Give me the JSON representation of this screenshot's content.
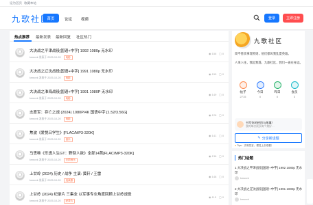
{
  "topbar": {
    "links": [
      "设为首页",
      "收藏本站"
    ]
  },
  "header": {
    "logo": "九歌社区",
    "nav": {
      "home": "首页",
      "forum": "论坛",
      "video": "视频"
    },
    "login": "登录",
    "register": "立即注册"
  },
  "tabs": [
    "热点推荐",
    "最新发表",
    "最新回复",
    "社区热门"
  ],
  "posts": [
    {
      "title": "大决战之平津战役[国语+中字] 1992 1080p 无水印",
      "author": "kmsvvk",
      "date": "发表于 2025-10-20",
      "tag": "电影",
      "views": "156",
      "replies": "0"
    },
    {
      "title": "大决战之辽沈战役[国语+中字] 1991 1080p 无水印",
      "author": "kmsvvk",
      "date": "发表于 2025-10-20",
      "tag": "电影",
      "views": "155",
      "replies": "0"
    },
    {
      "title": "大决战之淮海战役[国语+中字] 1991 1080P 无水印",
      "author": "kmsvvk",
      "date": "发表于 2025-10-20",
      "tag": "电影",
      "views": "149",
      "replies": "0"
    },
    {
      "title": "志愿军：存亡之战 (2024) 1080P/4K 国语中字 [1.52/3.56G]",
      "author": "kmsvvk",
      "date": "发表于 2025-10-20",
      "tag": "电影",
      "views": "128",
      "replies": "0"
    },
    {
      "title": "焦波《爱悦日学生》[FLAC/MP3-320K]",
      "author": "kmsvvk",
      "date": "发表于 2025-10-20",
      "tag": "音乐",
      "views": "141",
      "replies": "0"
    },
    {
      "title": "马思唯《乐透人生GT：野刻人欲》全部14首[FLAC/MP3-320K]",
      "author": "kmsvvk",
      "date": "发表于 2025-10-20",
      "tag": "无损音乐",
      "views": "136",
      "replies": "0"
    },
    {
      "title": "上甘岭 (2024) 历史 / 战争 主演: 黄轩 / 王雷",
      "author": "kmsvvk",
      "date": "发表于 2025-10-20",
      "tag": "连续剧",
      "views": "148",
      "replies": "0"
    },
    {
      "title": "上甘岭 (2024) 纪录片 三集全 以军事专业角度回顾上甘岭战役",
      "author": "kmsvvk",
      "date": "发表于 2025-10-20",
      "tag": "纪录片",
      "views": "115",
      "replies": "0"
    }
  ],
  "sidebar": {
    "name": "九歌社区",
    "desc1": "简不善欢事理原则，他们都叫我乱夏英雄。",
    "desc2": "人来人往，我起我落，九歌社区，我们一直在身边。",
    "stats": [
      {
        "label": "帖子",
        "value": "2715",
        "color": "#ff8a4c"
      },
      {
        "label": "今日",
        "value": "0",
        "color": "#2f7cff"
      },
      {
        "label": "昨日",
        "value": "0",
        "color": "#26b36b"
      },
      {
        "label": "会员",
        "value": "3",
        "color": "#14b8c8"
      }
    ],
    "promo_title": "书写你的经历与故事！",
    "promo_sub": "我的每次成长每个美好…",
    "share": "分享新话题",
    "tip": "Tips：文明发言，理性上去观看！"
  },
  "hot": {
    "title": "热门话题",
    "items": [
      {
        "title": "1  大决战之平津战役[国语+中字] 1992 1080p 无水印",
        "author": "kmsvvk"
      },
      {
        "title": "2  大决战之辽沈战役[国语+中字] 1991 1080p 无水印",
        "author": "kmsvvk"
      }
    ]
  },
  "colors": {
    "accent": "#1677ff",
    "register": "#ff4d4f",
    "tag": "#ff6a3d"
  }
}
